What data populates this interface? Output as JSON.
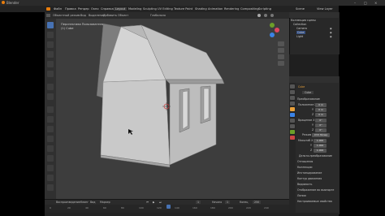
{
  "window": {
    "title": "Blender"
  },
  "menubar": {
    "items": [
      "Файл",
      "Правка",
      "Рендер",
      "Окно",
      "Справка"
    ],
    "workspaces": [
      "Layout",
      "Modeling",
      "Sculpting",
      "UV Editing",
      "Texture Paint",
      "Shading",
      "Animation",
      "Rendering",
      "Compositing",
      "Scripting"
    ],
    "scene_label": "Scene",
    "viewlayer_label": "View Layer"
  },
  "viewport_header": {
    "mode": "Объектный режим",
    "menus": [
      "Вид",
      "Выделение",
      "Добавить",
      "Объект"
    ],
    "transform": "Глобально"
  },
  "viewport_info": {
    "line1": "Перспектива Пользователя",
    "line2": "(1) Cube"
  },
  "outliner": {
    "rows": [
      "Коллекция сцены",
      "Collection",
      "Camera",
      "Cube",
      "Light"
    ]
  },
  "properties": {
    "object_name": "Cube",
    "tab_label": "Cube",
    "section": "Преобразование",
    "rows": [
      {
        "label": "Положение X",
        "value": "0 m"
      },
      {
        "label": "Y",
        "value": "0 m"
      },
      {
        "label": "Z",
        "value": "0 m"
      },
      {
        "label": "Вращение X",
        "value": "0°"
      },
      {
        "label": "Y",
        "value": "0°"
      },
      {
        "label": "Z",
        "value": "0°"
      },
      {
        "label": "Режим",
        "value": "XYZ Эйлер"
      },
      {
        "label": "Масштаб X",
        "value": "1.000"
      },
      {
        "label": "Y",
        "value": "1.000"
      },
      {
        "label": "Z",
        "value": "1.000"
      }
    ],
    "collapsed": [
      "Дельта-преобразование",
      "Отношения",
      "Коллекции",
      "Инстанцирование",
      "Контур движения",
      "Видимость",
      "Отображение во вьюпорте",
      "Линии",
      "Настраиваемые свойства"
    ]
  },
  "timeline": {
    "menus": [
      "Воспроизведение",
      "Кеинг",
      "Вид",
      "Маркер"
    ],
    "start_label": "Начало",
    "start": "1",
    "end_label": "Конец",
    "end": "250",
    "current": "1",
    "ticks": [
      "0",
      "20",
      "40",
      "60",
      "80",
      "100",
      "120",
      "140",
      "160",
      "180",
      "200",
      "220",
      "240"
    ]
  },
  "colors": {
    "accent": "#4772b3",
    "viewport_bg": "#3d3d3d",
    "panel_bg": "#2a2a2a",
    "selection_orange": "#e8a03a"
  }
}
